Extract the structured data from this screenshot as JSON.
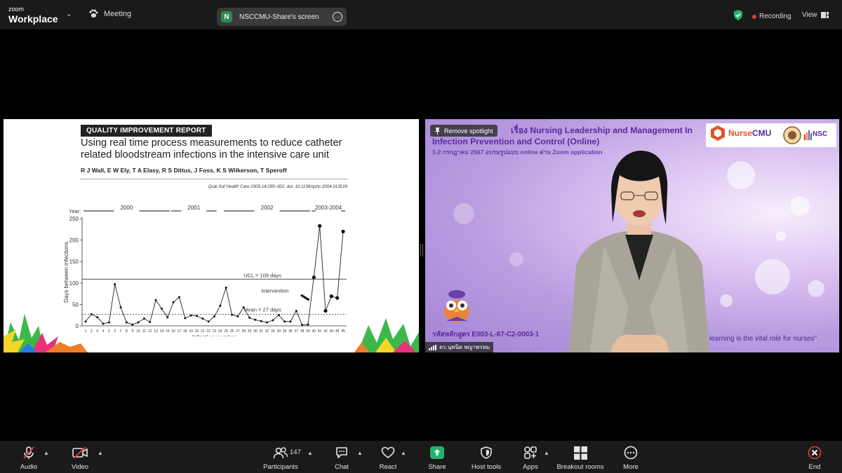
{
  "app": {
    "brand_small": "zoom",
    "brand_name": "Workplace"
  },
  "topbar": {
    "meeting_label": "Meeting",
    "share_badge": "N",
    "share_label": "NSCCMU-Share's screen",
    "recording_label": "Recording",
    "view_label": "View"
  },
  "slide": {
    "report_badge": "QUALITY IMPROVEMENT REPORT",
    "title": "Using real time process measurements to reduce catheter related bloodstream infections in the intensive care unit",
    "authors": "R J Wall, E W Ely, T A Elasy, R S Dittus, J Foss, K S Wilkerson, T Speroff",
    "citation": "Qual Saf Health Care 2005;14:295–302. doi: 10.1136/qshc.2004.013516"
  },
  "chart_data": {
    "type": "line",
    "xlabel": "Infection number",
    "ylabel": "Days between infections",
    "year_label": "Year:",
    "year_groups": [
      {
        "label": "2000",
        "from": 1,
        "to": 15
      },
      {
        "label": "2001",
        "from": 16,
        "to": 23
      },
      {
        "label": "2002",
        "from": 25,
        "to": 39
      },
      {
        "label": "2003-2004",
        "from": 40,
        "to": 45
      }
    ],
    "x": [
      1,
      2,
      3,
      4,
      5,
      6,
      7,
      8,
      9,
      10,
      11,
      12,
      13,
      14,
      15,
      16,
      17,
      18,
      19,
      20,
      21,
      22,
      23,
      24,
      25,
      26,
      27,
      28,
      29,
      30,
      31,
      32,
      33,
      34,
      35,
      36,
      37,
      38,
      39,
      40,
      41,
      42,
      43,
      44,
      45
    ],
    "values": [
      10,
      27,
      20,
      5,
      8,
      97,
      43,
      8,
      3,
      8,
      17,
      9,
      60,
      40,
      20,
      55,
      67,
      18,
      24,
      23,
      17,
      10,
      22,
      47,
      89,
      26,
      22,
      43,
      19,
      14,
      11,
      8,
      13,
      25,
      10,
      10,
      35,
      2,
      3,
      113,
      233,
      35,
      69,
      65,
      220
    ],
    "ylim": [
      0,
      250
    ],
    "yticks": [
      0,
      50,
      100,
      150,
      200,
      250
    ],
    "ucl": {
      "label": "UCL = 109 days",
      "value": 109
    },
    "mean": {
      "label": "Mean = 27 days",
      "value": 27
    },
    "annotation": "Intervention"
  },
  "video": {
    "spotlight_label": "Remove spotlight",
    "course_title": "เรื่อง Nursing Leadership and Management In Infection Prevention and Control  (Online)",
    "course_sub": "1-2 กรกฎาคม 2567 อบรมรูปแบบ online ผ่าน Zoom application",
    "logo_nurse": "Nurse",
    "logo_cmu": "CMU",
    "logo_nsc": "NSC",
    "course_code": "รหัสหลักสูตร E003-L-67-C2-0003-1",
    "slogan": "learning is the vital role for nurses\"",
    "participant_name": "ดร.นุพนิต พญาพรหม"
  },
  "toolbar": {
    "audio": "Audio",
    "video": "Video",
    "participants": "Participants",
    "participant_count": "147",
    "chat": "Chat",
    "react": "React",
    "share": "Share",
    "host_tools": "Host tools",
    "apps": "Apps",
    "breakout": "Breakout rooms",
    "more": "More",
    "end": "End"
  },
  "colors": {
    "toolbar_bg": "#1a1a1a",
    "share_green": "#23b26d",
    "end_red": "#e23b3b",
    "video_purple": "#5a2aa0"
  }
}
